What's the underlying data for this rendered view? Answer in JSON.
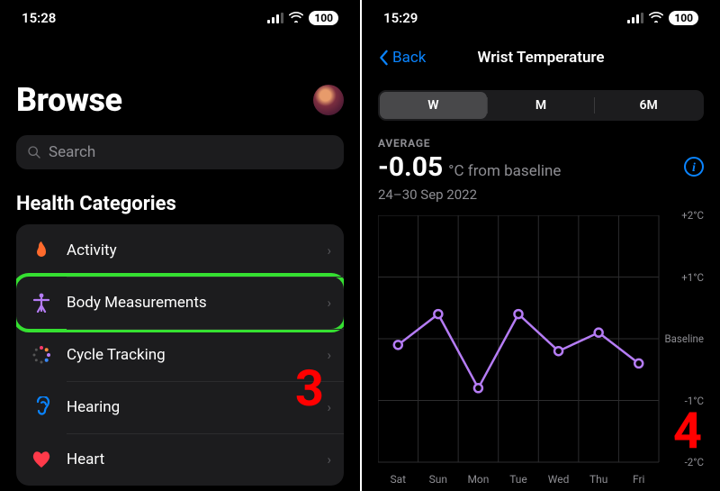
{
  "left": {
    "status": {
      "time": "15:28",
      "battery": "100"
    },
    "title": "Browse",
    "search_placeholder": "Search",
    "section_title": "Health Categories",
    "categories": [
      {
        "label": "Activity"
      },
      {
        "label": "Body Measurements"
      },
      {
        "label": "Cycle Tracking"
      },
      {
        "label": "Hearing"
      },
      {
        "label": "Heart"
      }
    ],
    "step_number": "3"
  },
  "right": {
    "status": {
      "time": "15:29",
      "battery": "100"
    },
    "back_label": "Back",
    "nav_title": "Wrist Temperature",
    "segments": [
      {
        "label": "W",
        "active": true
      },
      {
        "label": "M",
        "active": false
      },
      {
        "label": "6M",
        "active": false
      }
    ],
    "avg_label": "AVERAGE",
    "avg_value": "-0.05",
    "avg_unit": "°C from baseline",
    "avg_date": "24–30 Sep 2022",
    "step_number": "4"
  },
  "chart_data": {
    "type": "line",
    "title": "Wrist Temperature",
    "ylabel": "°C from baseline",
    "ylim": [
      -2,
      2
    ],
    "y_ticks": [
      "+2°C",
      "+1°C",
      "Baseline",
      "-1°C",
      "-2°C"
    ],
    "categories": [
      "Sat",
      "Sun",
      "Mon",
      "Tue",
      "Wed",
      "Thu",
      "Fri"
    ],
    "values": [
      -0.1,
      0.4,
      -0.8,
      0.4,
      -0.2,
      0.1,
      -0.4
    ],
    "color": "#b57cf5"
  }
}
